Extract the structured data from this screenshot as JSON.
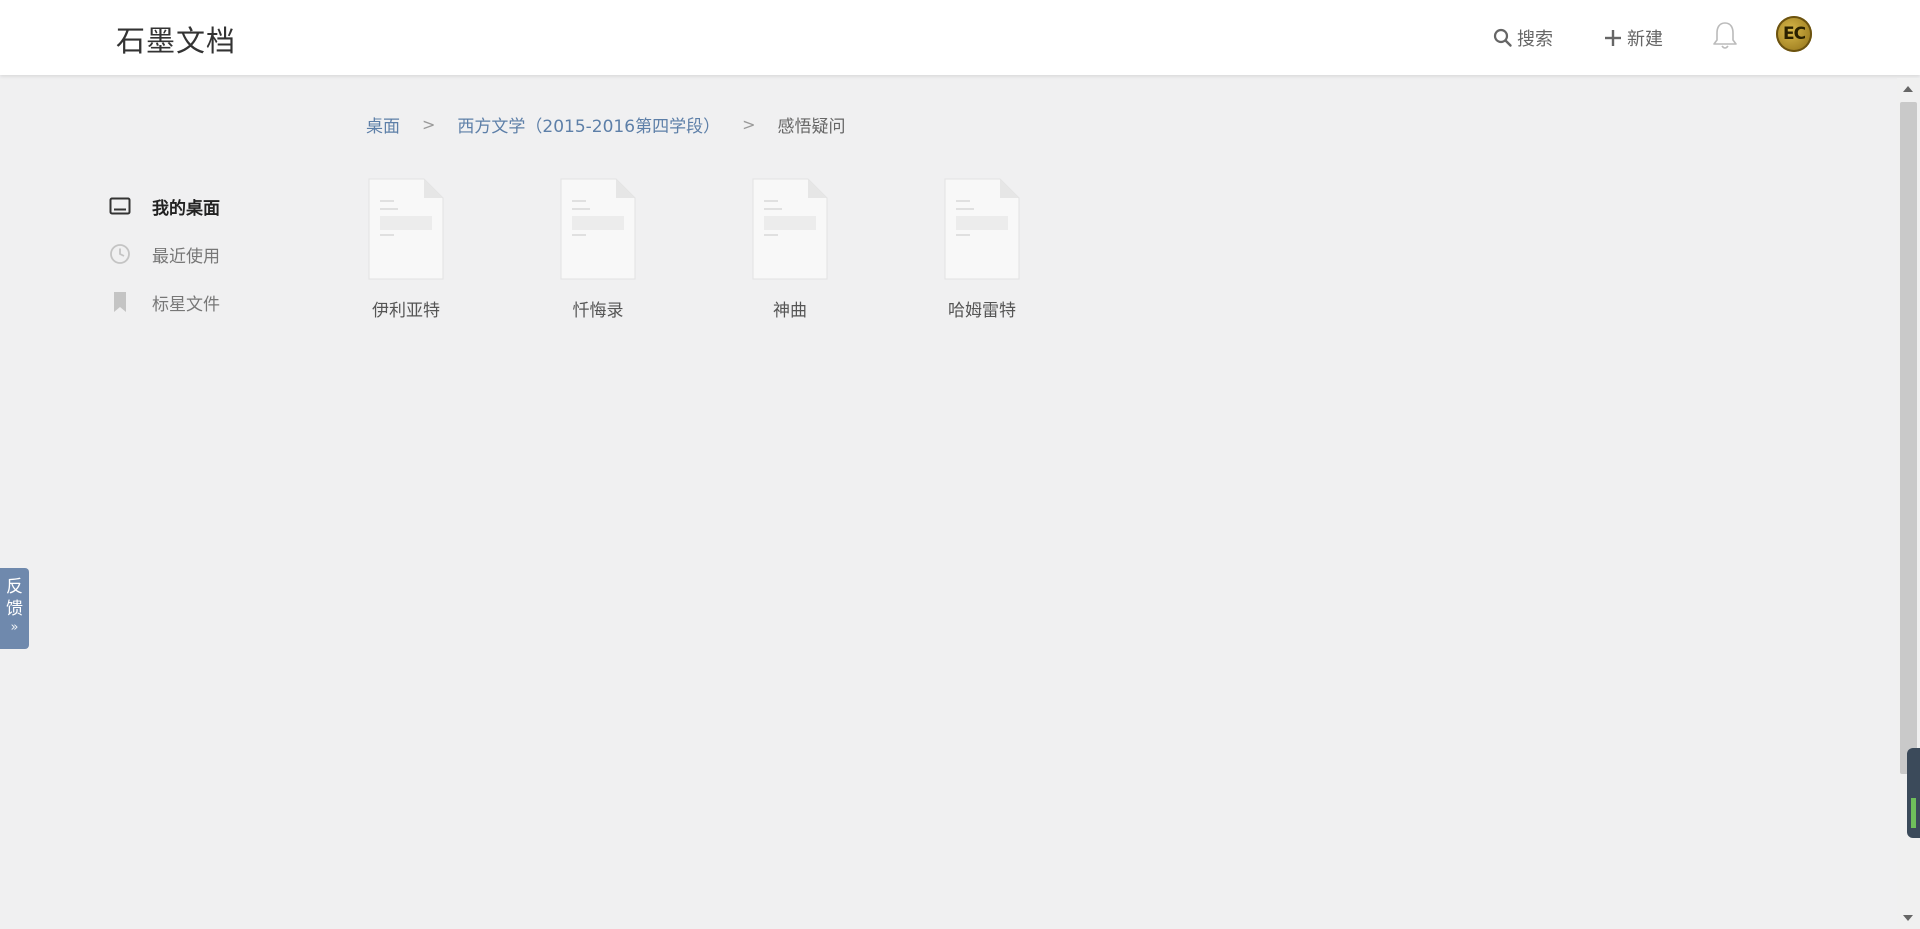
{
  "header": {
    "logo": "石墨文档",
    "search_label": "搜索",
    "new_label": "新建",
    "avatar_text": "EC"
  },
  "breadcrumb": {
    "items": [
      "桌面",
      "西方文学（2015-2016第四学段）",
      "感悟疑问"
    ]
  },
  "sidebar": {
    "items": [
      {
        "label": "我的桌面",
        "icon": "desktop-icon",
        "active": true
      },
      {
        "label": "最近使用",
        "icon": "clock-icon",
        "active": false
      },
      {
        "label": "标星文件",
        "icon": "bookmark-icon",
        "active": false
      }
    ]
  },
  "files": [
    {
      "name": "伊利亚特"
    },
    {
      "name": "忏悔录"
    },
    {
      "name": "神曲"
    },
    {
      "name": "哈姆雷特"
    }
  ],
  "feedback": {
    "label_line1": "反",
    "label_line2": "馈",
    "arrow": "»"
  },
  "colors": {
    "background": "#f0f0f1",
    "link": "#5d7fa8",
    "feedback_tab": "#6f89ad"
  }
}
